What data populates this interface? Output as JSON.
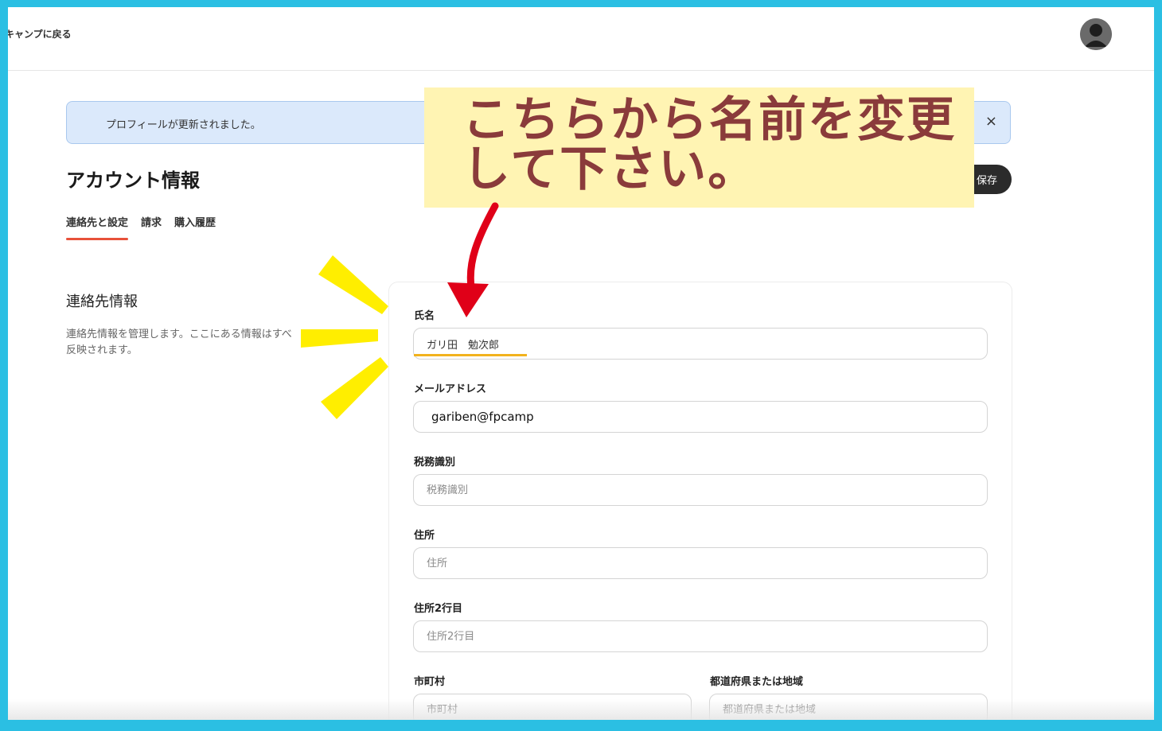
{
  "topbar": {
    "back_label": "キャンプに戻る"
  },
  "alert": {
    "message": "プロフィールが更新されました。",
    "close_glyph": "×"
  },
  "header": {
    "title": "アカウント情報",
    "save_label": "保存"
  },
  "tabs": [
    {
      "label": "連絡先と設定",
      "active": true
    },
    {
      "label": "請求",
      "active": false
    },
    {
      "label": "購入履歴",
      "active": false
    }
  ],
  "contact_section": {
    "title": "連絡先情報",
    "description_line1": "連絡先情報を管理します。ここにある情報はすべ",
    "description_line2": "反映されます。"
  },
  "form": {
    "name_label": "氏名",
    "name_value": "ガリ田　勉次郎",
    "email_label": "メールアドレス",
    "email_value": "gariben@fpcamp",
    "tax_label": "税務識別",
    "tax_placeholder": "税務識別",
    "address_label": "住所",
    "address_placeholder": "住所",
    "address2_label": "住所2行目",
    "address2_placeholder": "住所2行目",
    "city_label": "市町村",
    "city_placeholder": "市町村",
    "prefecture_label": "都道府県または地域",
    "prefecture_placeholder": "都道府県または地域"
  },
  "annotation": {
    "line1": "こちらから名前を変更",
    "line2": "して下さい。",
    "note_color": "#fff4b3",
    "text_color": "#8a3b3b",
    "arrow_color": "#e00018",
    "burst_color": "#ffee00",
    "underline_color": "#f2b21d"
  },
  "colors": {
    "frame_border": "#2bbfe3",
    "tab_underline": "#e8513a",
    "alert_bg": "#dbe9fb"
  }
}
